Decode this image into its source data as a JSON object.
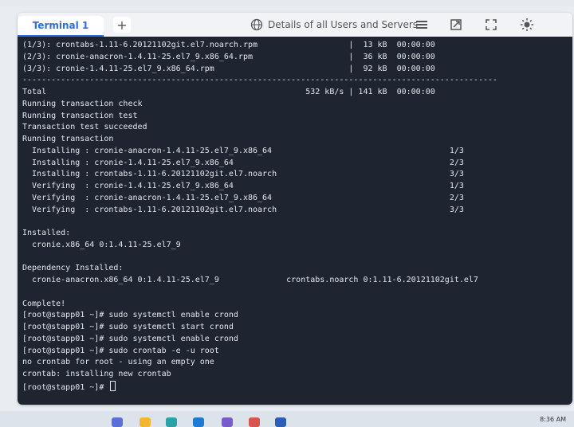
{
  "tabs": [
    {
      "label": "Terminal 1"
    }
  ],
  "add_tab_label": "+",
  "header": {
    "title": "Details of all Users and Servers"
  },
  "icons": {
    "globe": "globe-icon",
    "menu": "hamburger-menu-icon",
    "open": "open-external-icon",
    "fullscreen": "fullscreen-icon",
    "theme": "sun-icon"
  },
  "terminal": {
    "lines": [
      "(1/3): crontabs-1.11-6.20121102git.el7.noarch.rpm                   |  13 kB  00:00:00",
      "(2/3): cronie-anacron-1.4.11-25.el7_9.x86_64.rpm                    |  36 kB  00:00:00",
      "(3/3): cronie-1.4.11-25.el7_9.x86_64.rpm                            |  92 kB  00:00:00",
      "---------------------------------------------------------------------------------------------------",
      "Total                                                      532 kB/s | 141 kB  00:00:00",
      "Running transaction check",
      "Running transaction test",
      "Transaction test succeeded",
      "Running transaction",
      "  Installing : cronie-anacron-1.4.11-25.el7_9.x86_64                                     1/3",
      "  Installing : cronie-1.4.11-25.el7_9.x86_64                                             2/3",
      "  Installing : crontabs-1.11-6.20121102git.el7.noarch                                    3/3",
      "  Verifying  : cronie-1.4.11-25.el7_9.x86_64                                             1/3",
      "  Verifying  : cronie-anacron-1.4.11-25.el7_9.x86_64                                     2/3",
      "  Verifying  : crontabs-1.11-6.20121102git.el7.noarch                                    3/3",
      "",
      "Installed:",
      "  cronie.x86_64 0:1.4.11-25.el7_9",
      "",
      "Dependency Installed:",
      "  cronie-anacron.x86_64 0:1.4.11-25.el7_9              crontabs.noarch 0:1.11-6.20121102git.el7",
      "",
      "Complete!",
      "[root@stapp01 ~]# sudo systemctl enable crond",
      "[root@stapp01 ~]# sudo systemctl start crond",
      "[root@stapp01 ~]# sudo systemctl enable crond",
      "[root@stapp01 ~]# sudo crontab -e -u root",
      "no crontab for root - using an empty one",
      "crontab: installing new crontab"
    ],
    "prompt": "[root@stapp01 ~]# "
  },
  "taskbar": {
    "time": "8:36 AM"
  },
  "colors": {
    "terminal_bg": "#1e2430",
    "accent": "#2f6de0",
    "terminal_fg": "#e4e6ea"
  }
}
